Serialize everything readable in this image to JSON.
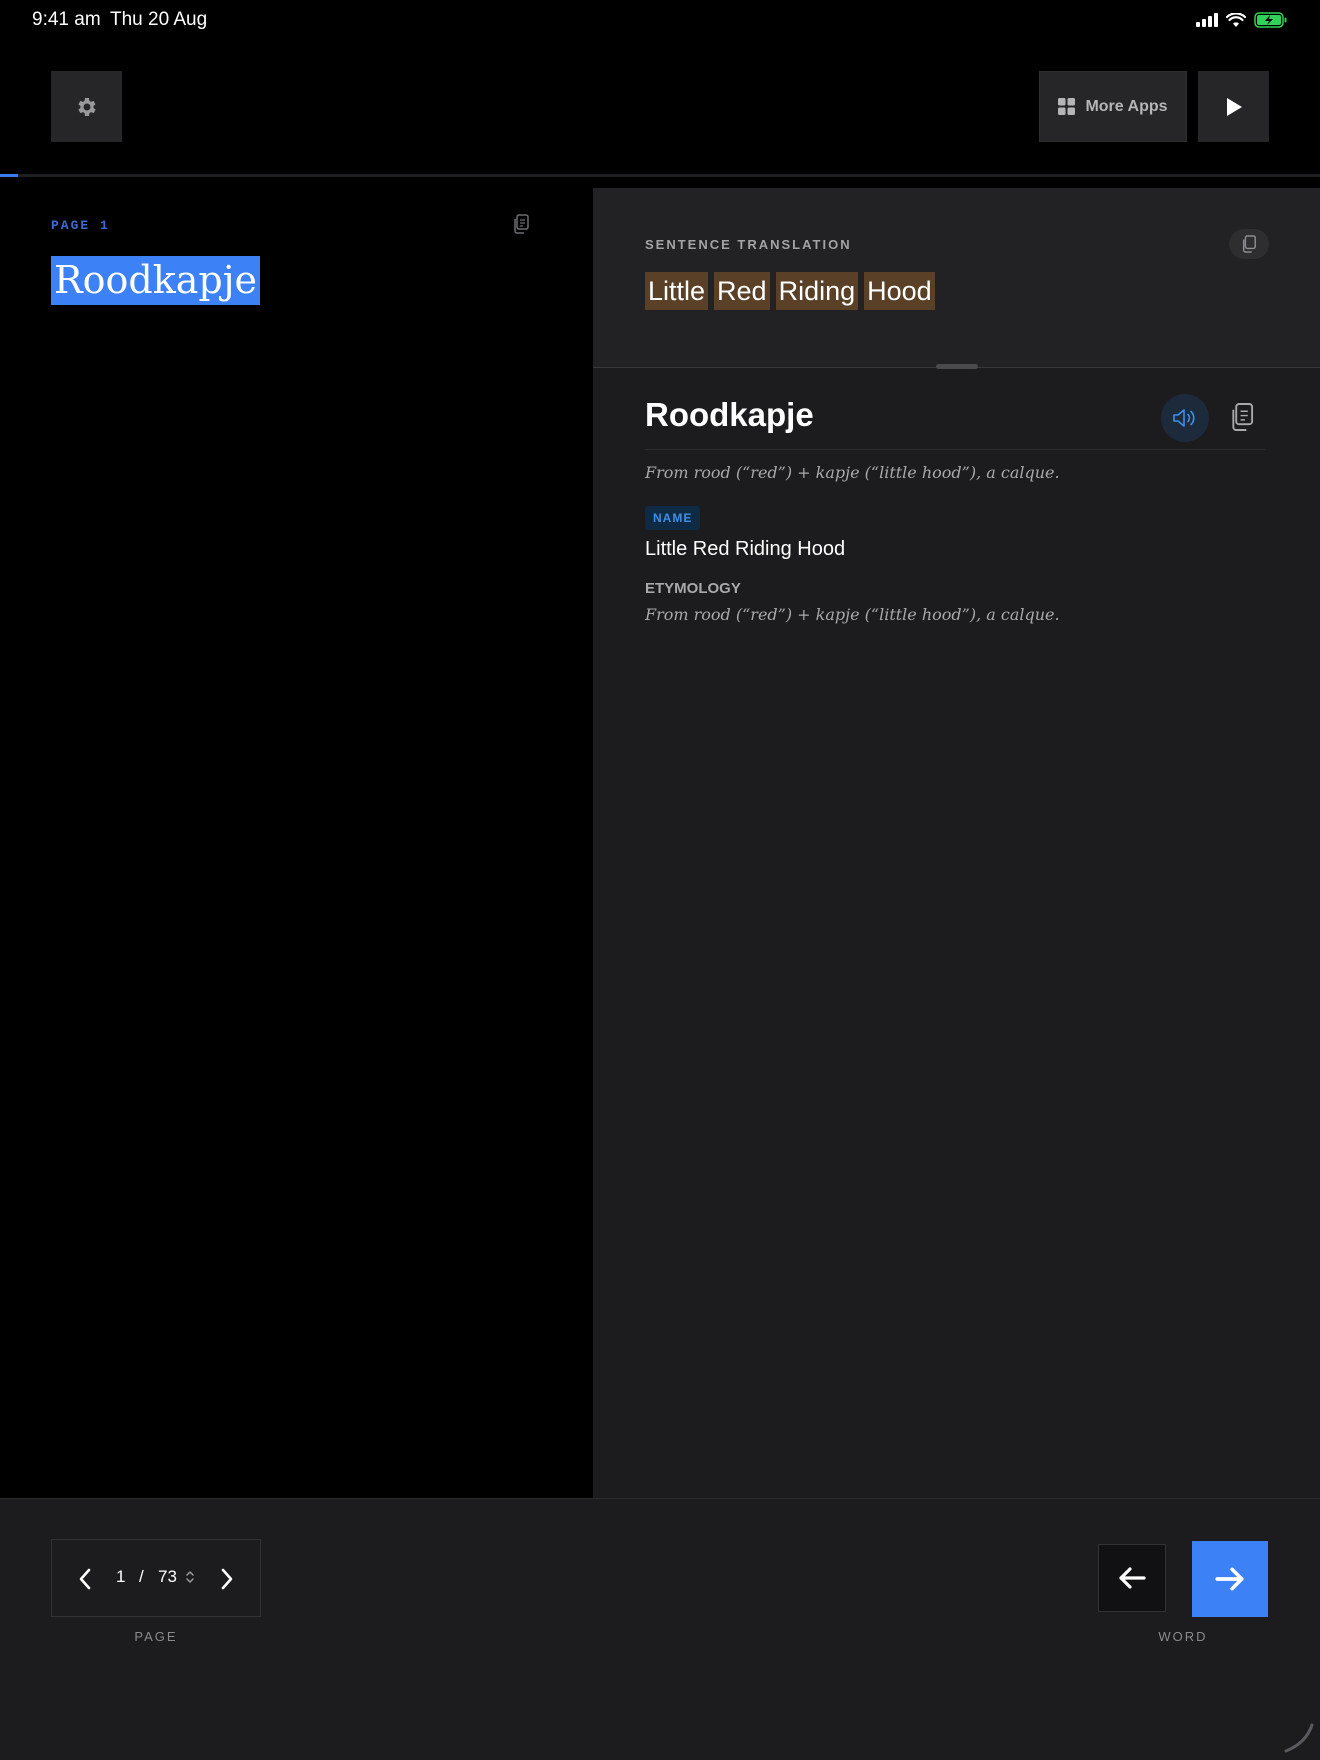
{
  "status_bar": {
    "time": "9:41 am",
    "date": "Thu 20 Aug",
    "battery_color": "#30d158"
  },
  "toolbar": {
    "settings_icon": "gear-icon",
    "more_apps_label": "More Apps",
    "more_apps_icon": "grid-icon",
    "play_icon": "play-icon"
  },
  "progress": {
    "fraction": 0.0137,
    "color": "#3a7bf0"
  },
  "source": {
    "page_label": "PAGE 1",
    "highlighted_word": "Roodkapje",
    "highlight_color": "#3c82f6"
  },
  "translation": {
    "label": "SENTENCE TRANSLATION",
    "words": [
      "Little",
      "Red",
      "Riding",
      "Hood"
    ],
    "chip_color": "#5a4026"
  },
  "dictionary": {
    "word": "Roodkapje",
    "etymology_summary": "From rood (“red”) + kapje (“little hood”), a calque.",
    "part_of_speech": "NAME",
    "definition": "Little Red Riding Hood",
    "etymology_heading": "ETYMOLOGY",
    "etymology_text": "From rood (“red”) + kapje (“little hood”), a calque."
  },
  "pager": {
    "current": "1",
    "separator": "/",
    "total": "73",
    "caption": "PAGE"
  },
  "word_nav": {
    "caption": "WORD",
    "accent": "#3c82f6"
  }
}
